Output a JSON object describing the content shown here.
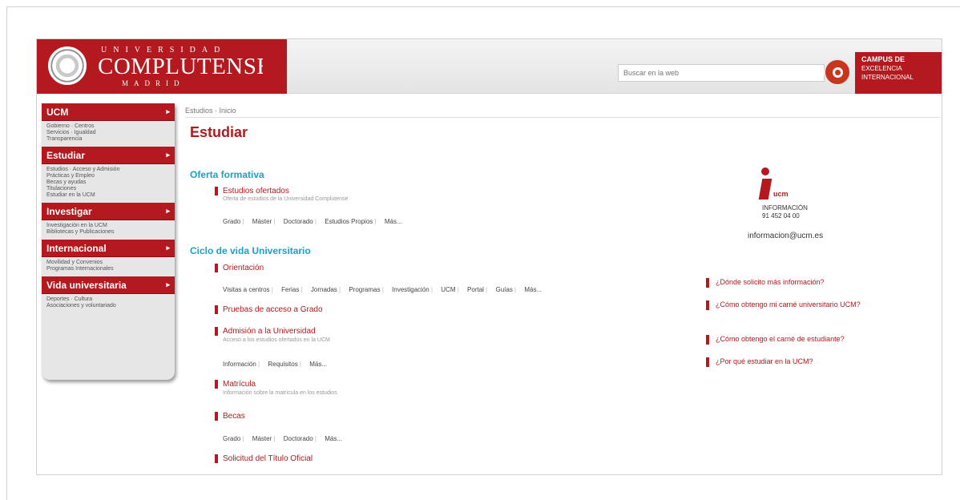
{
  "header": {
    "logo_top": "UNIVERSIDAD",
    "logo_main": "COMPLUTENSE",
    "logo_bottom": "MADRID",
    "search_placeholder": "Buscar en la web",
    "campus_line1": "CAMPUS DE",
    "campus_line2": "EXCELENCIA",
    "campus_line3": "INTERNACIONAL"
  },
  "sidebar": {
    "sections": [
      {
        "title": "UCM",
        "items": [
          "Gobierno · Centros",
          "Servicios · Igualdad",
          "Transparencia"
        ]
      },
      {
        "title": "Estudiar",
        "items": [
          "Estudios · Acceso y Admisión",
          "Prácticas y Empleo",
          "Becas y ayudas",
          "Titulaciones",
          "Estudiar en la UCM"
        ]
      },
      {
        "title": "Investigar",
        "items": [
          "Investigación en la UCM",
          "Bibliotecas y Publicaciones"
        ]
      },
      {
        "title": "Internacional",
        "items": [
          "Movilidad y Convenios",
          "Programas Internacionales"
        ]
      },
      {
        "title": "Vida universitaria",
        "items": [
          "Deportes · Cultura",
          "Asociaciones y voluntariado"
        ]
      }
    ]
  },
  "main": {
    "breadcrumb": "Estudios · Inicio",
    "title": "Estudiar",
    "oferta_title": "Oferta formativa",
    "estudios_ofertados": "Estudios ofertados",
    "estudios_desc": "Oferta de estudios de la Universidad Complutense",
    "oferta_links": [
      "Grado",
      "Máster",
      "Doctorado",
      "Estudios Propios",
      "Más..."
    ],
    "ciclo_title": "Ciclo de vida Universitario",
    "orientacion": "Orientación",
    "orientacion_links": [
      "Visitas a centros",
      "Ferias",
      "Jornadas",
      "Programas",
      "Investigación",
      "UCM",
      "Portal",
      "Guías",
      "Más..."
    ],
    "pruebas": "Pruebas de acceso a Grado",
    "admision": "Admisión a la Universidad",
    "admision_desc": "Acceso a los estudios ofertados en la UCM",
    "admision_links": [
      "Información",
      "Requisitos",
      "Más..."
    ],
    "matricula": "Matrícula",
    "matricula_desc": "Información sobre la matrícula en los estudios",
    "becas": "Becas",
    "becas_links": [
      "Grado",
      "Máster",
      "Doctorado",
      "Más..."
    ],
    "solicitud": "Solicitud del Título Oficial"
  },
  "right": {
    "icon_label": "ucm",
    "icon_sub1": "INFORMACIÓN",
    "icon_sub2": "91 452 04 00",
    "mail": "informacion@ucm.es",
    "faqs": [
      "¿Dónde solicito más información?",
      "¿Cómo obtengo mi carné universitario UCM?",
      "¿Cómo obtengo el carné de estudiante?",
      "¿Por qué estudiar en la UCM?"
    ]
  }
}
